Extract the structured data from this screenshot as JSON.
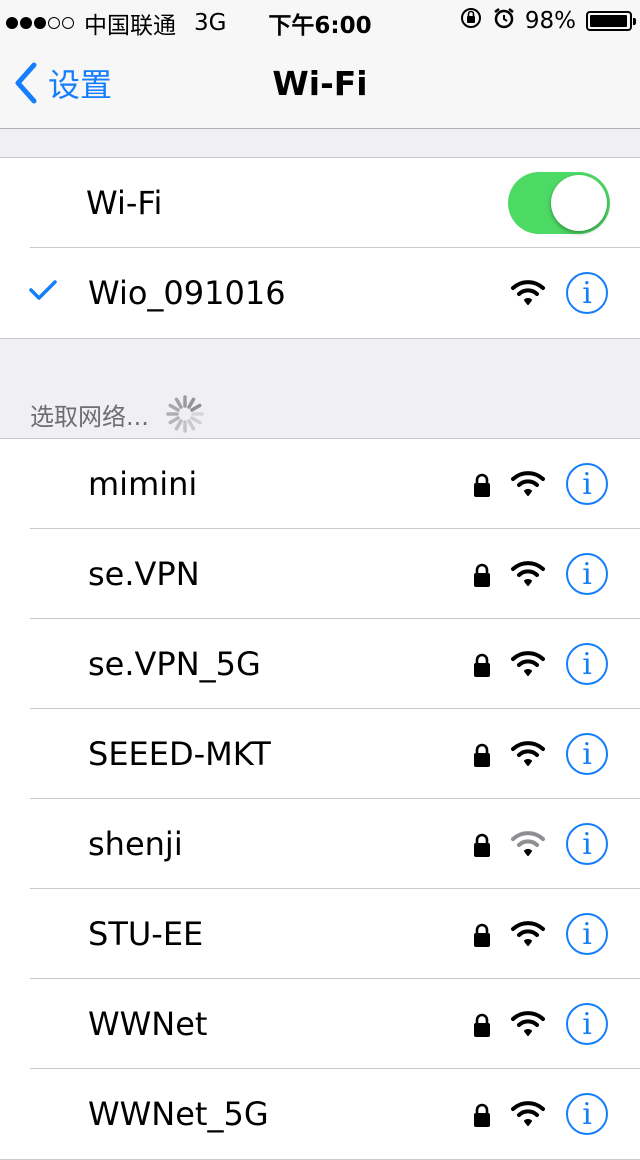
{
  "status_bar": {
    "carrier": "中国联通",
    "network": "3G",
    "time": "下午6:00",
    "battery": "98%",
    "battery_level": 0.98,
    "signal_bars_filled": 3,
    "signal_bars_total": 5
  },
  "nav": {
    "back_label": "设置",
    "title": "Wi-Fi"
  },
  "wifi": {
    "label": "Wi-Fi",
    "enabled": true,
    "connected_network": "Wio_091016"
  },
  "choose_network_label": "选取网络...",
  "networks": [
    {
      "name": "mimini",
      "secured": true,
      "strength": "strong"
    },
    {
      "name": "se.VPN",
      "secured": true,
      "strength": "strong"
    },
    {
      "name": "se.VPN_5G",
      "secured": true,
      "strength": "strong"
    },
    {
      "name": "SEEED-MKT",
      "secured": true,
      "strength": "strong"
    },
    {
      "name": "shenji",
      "secured": true,
      "strength": "weak"
    },
    {
      "name": "STU-EE",
      "secured": true,
      "strength": "strong"
    },
    {
      "name": "WWNet",
      "secured": true,
      "strength": "strong"
    },
    {
      "name": "WWNet_5G",
      "secured": true,
      "strength": "strong"
    }
  ],
  "info_glyph": "i",
  "colors": {
    "accent": "#157efb",
    "toggle_on": "#4cd964",
    "background": "#efeff4"
  }
}
